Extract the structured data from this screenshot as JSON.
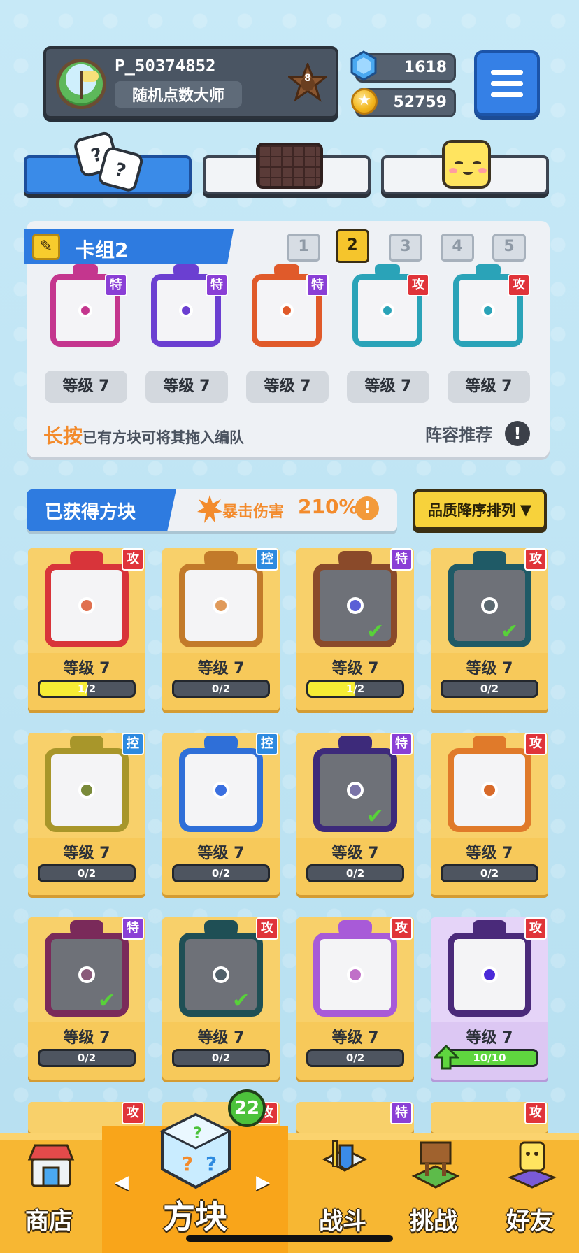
{
  "player": {
    "name": "P_50374852",
    "title": "随机点数大师",
    "rank": "8"
  },
  "currency": {
    "gems": "1618",
    "coins": "52759"
  },
  "top_tabs": [
    {
      "name": "dice",
      "active": true
    },
    {
      "name": "board",
      "active": false
    },
    {
      "name": "emoji",
      "active": false
    }
  ],
  "deck": {
    "title": "卡组2",
    "tabs": [
      "1",
      "2",
      "3",
      "4",
      "5"
    ],
    "active_tab": "2",
    "cards": [
      {
        "type": "特",
        "level": "等级 7",
        "color": "#c4368e"
      },
      {
        "type": "特",
        "level": "等级 7",
        "color": "#6b3fd1"
      },
      {
        "type": "特",
        "level": "等级 7",
        "color": "#e05a2a"
      },
      {
        "type": "攻",
        "level": "等级 7",
        "color": "#2aa3b8"
      },
      {
        "type": "攻",
        "level": "等级 7",
        "color": "#2aa3b8"
      }
    ],
    "hint_accent": "长按",
    "hint_rest": "已有方块可将其拖入编队",
    "recommend_label": "阵容推荐",
    "info_mark": "!"
  },
  "owned": {
    "title": "已获得方块",
    "crit_label": "暴击伤害",
    "crit_value": "210%",
    "info_mark": "!",
    "sort_label": "品质降序排列",
    "sort_arrow": "▼"
  },
  "grid_cards": [
    {
      "type": "攻",
      "level": "等级 7",
      "progress": "1/2",
      "progress_fraction": 0.5,
      "color": "#d8343a",
      "core": "#e0704f",
      "dim": false,
      "equipped": false
    },
    {
      "type": "控",
      "level": "等级 7",
      "progress": "0/2",
      "progress_fraction": 0,
      "color": "#c27a2a",
      "core": "#e09a5a",
      "dim": false,
      "equipped": false
    },
    {
      "type": "特",
      "level": "等级 7",
      "progress": "1/2",
      "progress_fraction": 0.5,
      "color": "#8a4a2a",
      "core": "#5a5fd6",
      "dim": true,
      "equipped": true
    },
    {
      "type": "攻",
      "level": "等级 7",
      "progress": "0/2",
      "progress_fraction": 0,
      "color": "#1f5a66",
      "core": "#5a6870",
      "dim": true,
      "equipped": true
    },
    {
      "type": "控",
      "level": "等级 7",
      "progress": "0/2",
      "progress_fraction": 0,
      "color": "#a8962a",
      "core": "#7a8a3a",
      "dim": false,
      "equipped": false
    },
    {
      "type": "控",
      "level": "等级 7",
      "progress": "0/2",
      "progress_fraction": 0,
      "color": "#2f6fd8",
      "core": "#3a6fe0",
      "dim": false,
      "equipped": false
    },
    {
      "type": "特",
      "level": "等级 7",
      "progress": "0/2",
      "progress_fraction": 0,
      "color": "#3d2a7a",
      "core": "#7a74a8",
      "dim": true,
      "equipped": true
    },
    {
      "type": "攻",
      "level": "等级 7",
      "progress": "0/2",
      "progress_fraction": 0,
      "color": "#e07a2a",
      "core": "#d86a2a",
      "dim": false,
      "equipped": false
    },
    {
      "type": "特",
      "level": "等级 7",
      "progress": "0/2",
      "progress_fraction": 0,
      "color": "#7a2a5a",
      "core": "#8a5a7a",
      "dim": true,
      "equipped": true
    },
    {
      "type": "攻",
      "level": "等级 7",
      "progress": "0/2",
      "progress_fraction": 0,
      "color": "#1f4f55",
      "core": "#50606a",
      "dim": true,
      "equipped": true
    },
    {
      "type": "攻",
      "level": "等级 7",
      "progress": "0/2",
      "progress_fraction": 0,
      "color": "#a85ad8",
      "core": "#c070c8",
      "dim": false,
      "equipped": false
    },
    {
      "type": "攻",
      "level": "等级 7",
      "progress": "10/10",
      "progress_fraction": 1,
      "color": "#4a2a7a",
      "core": "#4a2ad8",
      "dim": false,
      "equipped": false,
      "upgradeable": true
    }
  ],
  "partial_row_badges": [
    "攻",
    "攻",
    "特",
    "攻"
  ],
  "nav": {
    "shop": "商店",
    "blocks": "方块",
    "battle": "战斗",
    "challenge": "挑战",
    "friends": "好友",
    "arrow_left": "◀",
    "arrow_right": "▶",
    "blocks_count": "22"
  },
  "colors": {
    "accent_blue": "#2e7be0",
    "accent_yellow": "#f7d23b",
    "nav_orange": "#f7b733",
    "attack": "#e0343a",
    "special": "#8a3fd6",
    "control": "#2d8ae0"
  }
}
